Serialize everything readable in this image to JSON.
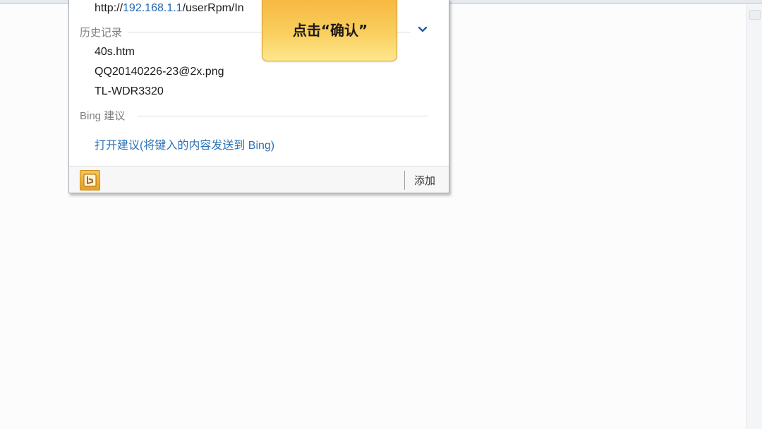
{
  "dropdown": {
    "url_suggestion": {
      "prefix": "http://",
      "host": "192.168.1.1",
      "path": "/userRpm/In"
    },
    "history_section": {
      "header": "历史记录",
      "items": [
        "40s.htm",
        "QQ20140226-23@2x.png",
        "TL-WDR3320"
      ]
    },
    "bing_section": {
      "header": "Bing 建议",
      "link": "打开建议(将键入的内容发送到 Bing)"
    },
    "footer": {
      "bing_icon": "bing-icon",
      "add_label": "添加"
    }
  },
  "callout": {
    "text": "点击“确认”"
  },
  "colors": {
    "link": "#2b73b8",
    "callout_top": "#f7b53d",
    "callout_bottom": "#fde88f",
    "bing_icon_bg": "#f0b23a"
  }
}
